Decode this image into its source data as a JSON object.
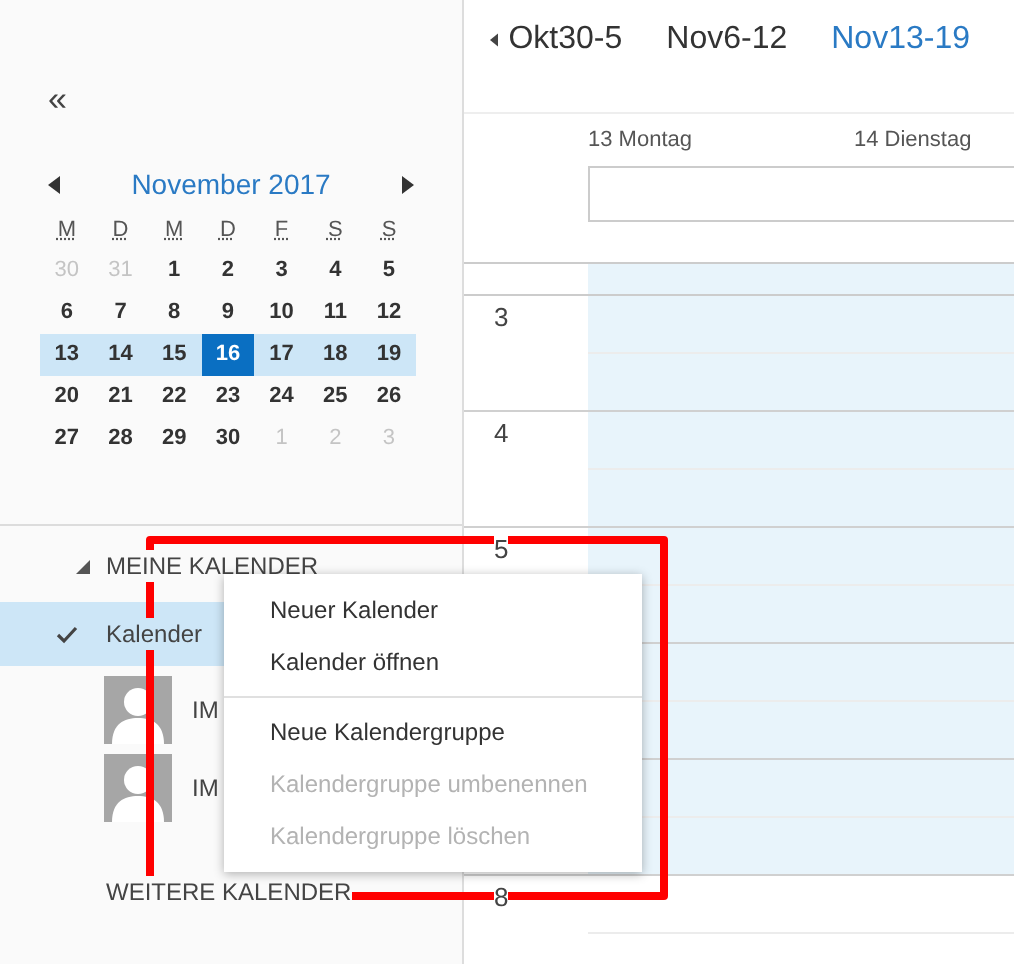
{
  "week_nav": {
    "items": [
      {
        "label": "Okt30-5",
        "selected": false
      },
      {
        "label": "Nov6-12",
        "selected": false
      },
      {
        "label": "Nov13-19",
        "selected": true
      }
    ]
  },
  "sidebar": {
    "collapse": "«",
    "mini_calendar": {
      "title": "November 2017",
      "weekdays": [
        "M",
        "D",
        "M",
        "D",
        "F",
        "S",
        "S"
      ],
      "weeks": [
        {
          "selected": false,
          "days": [
            {
              "day": "30",
              "other_month": true,
              "selected": false
            },
            {
              "day": "31",
              "other_month": true,
              "selected": false
            },
            {
              "day": "1",
              "other_month": false,
              "selected": false
            },
            {
              "day": "2",
              "other_month": false,
              "selected": false
            },
            {
              "day": "3",
              "other_month": false,
              "selected": false
            },
            {
              "day": "4",
              "other_month": false,
              "selected": false
            },
            {
              "day": "5",
              "other_month": false,
              "selected": false
            }
          ]
        },
        {
          "selected": false,
          "days": [
            {
              "day": "6",
              "other_month": false,
              "selected": false
            },
            {
              "day": "7",
              "other_month": false,
              "selected": false
            },
            {
              "day": "8",
              "other_month": false,
              "selected": false
            },
            {
              "day": "9",
              "other_month": false,
              "selected": false
            },
            {
              "day": "10",
              "other_month": false,
              "selected": false
            },
            {
              "day": "11",
              "other_month": false,
              "selected": false
            },
            {
              "day": "12",
              "other_month": false,
              "selected": false
            }
          ]
        },
        {
          "selected": true,
          "days": [
            {
              "day": "13",
              "other_month": false,
              "selected": false
            },
            {
              "day": "14",
              "other_month": false,
              "selected": false
            },
            {
              "day": "15",
              "other_month": false,
              "selected": false
            },
            {
              "day": "16",
              "other_month": false,
              "selected": true
            },
            {
              "day": "17",
              "other_month": false,
              "selected": false
            },
            {
              "day": "18",
              "other_month": false,
              "selected": false
            },
            {
              "day": "19",
              "other_month": false,
              "selected": false
            }
          ]
        },
        {
          "selected": false,
          "days": [
            {
              "day": "20",
              "other_month": false,
              "selected": false
            },
            {
              "day": "21",
              "other_month": false,
              "selected": false
            },
            {
              "day": "22",
              "other_month": false,
              "selected": false
            },
            {
              "day": "23",
              "other_month": false,
              "selected": false
            },
            {
              "day": "24",
              "other_month": false,
              "selected": false
            },
            {
              "day": "25",
              "other_month": false,
              "selected": false
            },
            {
              "day": "26",
              "other_month": false,
              "selected": false
            }
          ]
        },
        {
          "selected": false,
          "days": [
            {
              "day": "27",
              "other_month": false,
              "selected": false
            },
            {
              "day": "28",
              "other_month": false,
              "selected": false
            },
            {
              "day": "29",
              "other_month": false,
              "selected": false
            },
            {
              "day": "30",
              "other_month": false,
              "selected": false
            },
            {
              "day": "1",
              "other_month": true,
              "selected": false
            },
            {
              "day": "2",
              "other_month": true,
              "selected": false
            },
            {
              "day": "3",
              "other_month": true,
              "selected": false
            }
          ]
        }
      ]
    },
    "groups": [
      {
        "label": "MEINE KALENDER",
        "expanded": true,
        "items": [
          {
            "kind": "calendar",
            "label": "Kalender",
            "checked": true,
            "selected": true
          },
          {
            "kind": "person",
            "label": "IM",
            "selected": false
          },
          {
            "kind": "person",
            "label": "IM",
            "selected": false
          }
        ]
      },
      {
        "label": "WEITERE KALENDER",
        "expanded": false
      }
    ]
  },
  "week_view": {
    "days": [
      "13 Montag",
      "14 Dienstag"
    ],
    "hours": [
      {
        "label": "3",
        "working": true
      },
      {
        "label": "4",
        "working": true
      },
      {
        "label": "5",
        "working": true
      },
      {
        "working": true
      },
      {
        "working": true
      },
      {
        "label": "8",
        "working": false
      }
    ]
  },
  "context_menu": {
    "items": [
      {
        "kind": "item",
        "label": "Neuer Kalender",
        "disabled": false
      },
      {
        "kind": "item",
        "label": "Kalender öffnen",
        "disabled": false
      },
      {
        "kind": "separator"
      },
      {
        "kind": "item",
        "label": "Neue Kalendergruppe",
        "disabled": false
      },
      {
        "kind": "item",
        "label": "Kalendergruppe umbenennen",
        "disabled": true
      },
      {
        "kind": "item",
        "label": "Kalendergruppe löschen",
        "disabled": true
      }
    ]
  }
}
